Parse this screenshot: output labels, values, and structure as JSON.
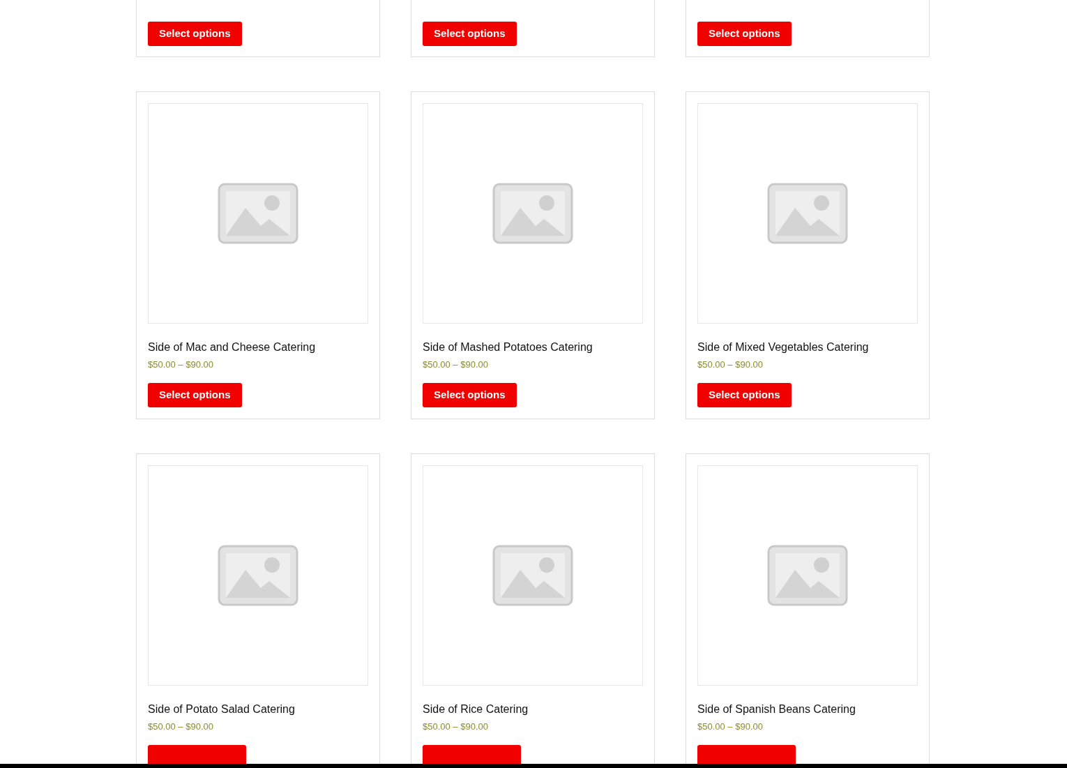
{
  "rows": [
    {
      "cards": [
        {
          "button": "Select options"
        },
        {
          "button": "Select options"
        },
        {
          "button": "Select options"
        }
      ]
    },
    {
      "cards": [
        {
          "image": true,
          "title": "Side of Mac and Cheese Catering",
          "price": "$50.00 – $90.00",
          "button": "Select options"
        },
        {
          "image": true,
          "title": "Side of Mashed Potatoes Catering",
          "price": "$50.00 – $90.00",
          "button": "Select options"
        },
        {
          "image": true,
          "title": "Side of Mixed Vegetables Catering",
          "price": "$50.00 – $90.00",
          "button": "Select options"
        }
      ]
    },
    {
      "cards": [
        {
          "image": true,
          "title": "Side of Potato Salad Catering",
          "price": "$50.00 – $90.00",
          "button_cut": true
        },
        {
          "image": true,
          "title": "Side of Rice Catering",
          "price": "$50.00 – $90.00",
          "button_cut": true
        },
        {
          "image": true,
          "title": "Side of Spanish Beans Catering",
          "price": "$50.00 – $90.00",
          "button_cut": true
        }
      ]
    }
  ]
}
